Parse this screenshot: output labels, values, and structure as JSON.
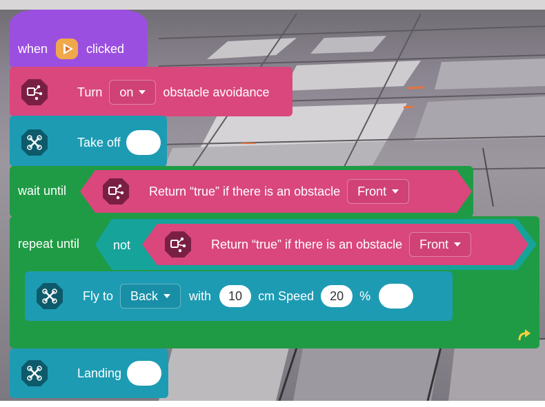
{
  "colors": {
    "event": "#9b4fe0",
    "extension": "#d9477c",
    "motion": "#1d9bb3",
    "control": "#1f9b45",
    "operator": "#16a39a"
  },
  "event_block": {
    "when": "when",
    "icon": "play-flag-icon",
    "clicked": "clicked"
  },
  "obstacle_block": {
    "icon": "drone-module-icon",
    "turn": "Turn",
    "value": "on",
    "suffix": "obstacle avoidance"
  },
  "takeoff_block": {
    "icon": "drone-icon",
    "label": "Take off"
  },
  "wait_block": {
    "label": "wait until",
    "condition": {
      "icon": "drone-module-icon",
      "text": "Return “true” if there is an obstacle",
      "direction": "Front"
    }
  },
  "repeat_block": {
    "label": "repeat until",
    "not_label": "not",
    "condition": {
      "icon": "drone-module-icon",
      "text": "Return “true” if there is an obstacle",
      "direction": "Front"
    },
    "loop_icon": "loop-arrow-icon"
  },
  "fly_block": {
    "icon": "drone-icon",
    "fly_to": "Fly to",
    "direction": "Back",
    "with": "with",
    "distance": "10",
    "cm_speed": "cm Speed",
    "speed": "20",
    "percent": "%"
  },
  "landing_block": {
    "icon": "drone-icon",
    "label": "Landing"
  }
}
